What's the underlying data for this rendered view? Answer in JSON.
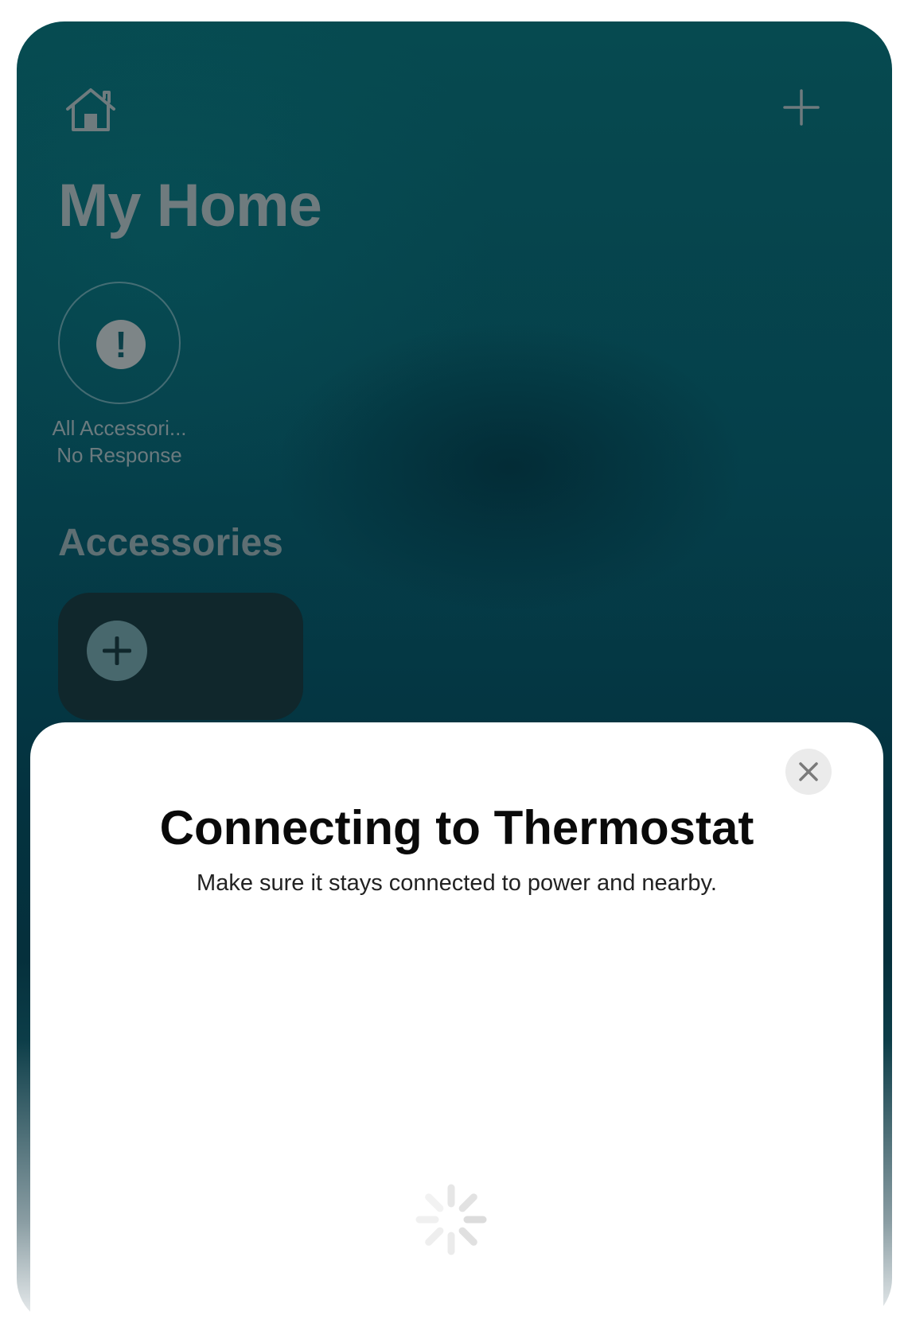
{
  "header": {
    "home_icon": "house-icon",
    "add_icon": "plus-icon",
    "title": "My Home"
  },
  "status": {
    "icon": "exclamation-circle-icon",
    "line1": "All Accessori...",
    "line2": "No Response"
  },
  "accessories": {
    "section_title": "Accessories",
    "add_tile_icon": "plus-circle-icon"
  },
  "sheet": {
    "title": "Connecting to Thermostat",
    "subtitle": "Make sure it stays connected to power and nearby.",
    "close_icon": "close-icon",
    "loading_icon": "spinner-icon"
  },
  "colors": {
    "background_top": "#064a50",
    "background_mid": "#04323f",
    "sheet": "#ffffff",
    "title_text": "#0a0a0a"
  }
}
